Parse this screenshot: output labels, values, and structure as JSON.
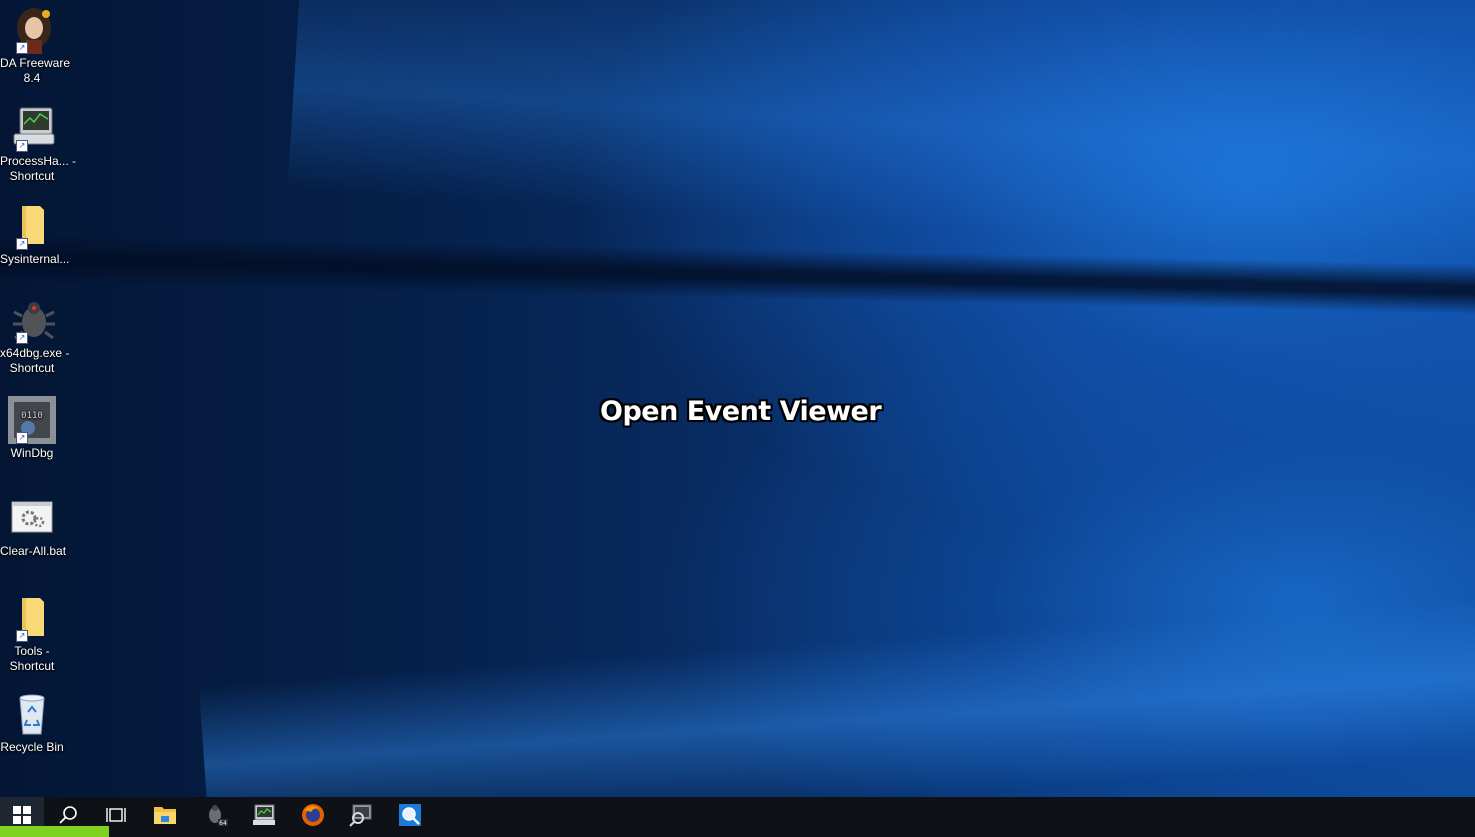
{
  "desktop": {
    "icons": [
      {
        "label": "DA Freeware 8.4",
        "icon": "ida-portrait-icon"
      },
      {
        "label": "ProcessHa... - Shortcut",
        "icon": "computer-monitor-icon"
      },
      {
        "label": "Sysinternal...",
        "icon": "folder-icon"
      },
      {
        "label": "x64dbg.exe - Shortcut",
        "icon": "bug-icon"
      },
      {
        "label": "WinDbg",
        "icon": "debugger-icon"
      },
      {
        "label": "Clear-All.bat",
        "icon": "batch-gears-icon"
      },
      {
        "label": "Tools - Shortcut",
        "icon": "folder-icon"
      },
      {
        "label": "Recycle Bin",
        "icon": "recycle-bin-icon"
      }
    ]
  },
  "caption": "Open Event Viewer",
  "taskbar": {
    "items": [
      "start-icon",
      "search-icon",
      "task-view-icon",
      "file-explorer-icon",
      "x64dbg-icon",
      "process-hacker-icon",
      "firefox-icon",
      "process-monitor-icon",
      "event-viewer-icon"
    ],
    "progress": 0.074
  },
  "colors": {
    "taskbar": "#0e1217",
    "progress": "#7ed321",
    "accent": "#1a6fd0"
  }
}
